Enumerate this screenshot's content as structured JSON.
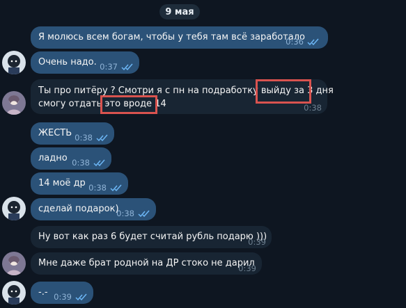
{
  "date_separator": "9 мая",
  "messages": [
    {
      "text": "Я молюсь всем богам, чтобы у тебя там всё заработало",
      "time": "0:36",
      "side": "out"
    },
    {
      "text": "Очень надо.",
      "time": "0:37",
      "side": "out"
    },
    {
      "line1": "Ты про питёру ? Смотри я с пн на подработку выйду за 3 дня",
      "line2": "смогу отдать это вроде 14",
      "time": "0:38",
      "side": "in"
    },
    {
      "text": "ЖЕСТЬ",
      "time": "0:38",
      "side": "out"
    },
    {
      "text": "ладно",
      "time": "0:38",
      "side": "out"
    },
    {
      "text": "14 моё др",
      "time": "0:38",
      "side": "out"
    },
    {
      "text": "сделай подарок)",
      "time": "0:38",
      "side": "out"
    },
    {
      "text": "Ну вот как раз 6 будет считай рубль подарю )))",
      "time": "0:39",
      "side": "in"
    },
    {
      "text": "Мне даже брат родной на ДР стоко не дарил",
      "time": "0:39",
      "side": "in"
    },
    {
      "text": "-.-",
      "time": "0:39",
      "side": "out"
    }
  ],
  "highlights": [
    "за 3 дня",
    "вроде 14"
  ],
  "colors": {
    "background": "#0e1621",
    "outgoing_bubble": "#2b5278",
    "incoming_bubble": "#182533",
    "read_checks": "#6cb6f5",
    "highlight_box": "#d9534f"
  },
  "icons": {
    "read_receipt": "double-check-icon",
    "avatar_self": "user-avatar-icon",
    "avatar_other": "contact-avatar-icon"
  }
}
